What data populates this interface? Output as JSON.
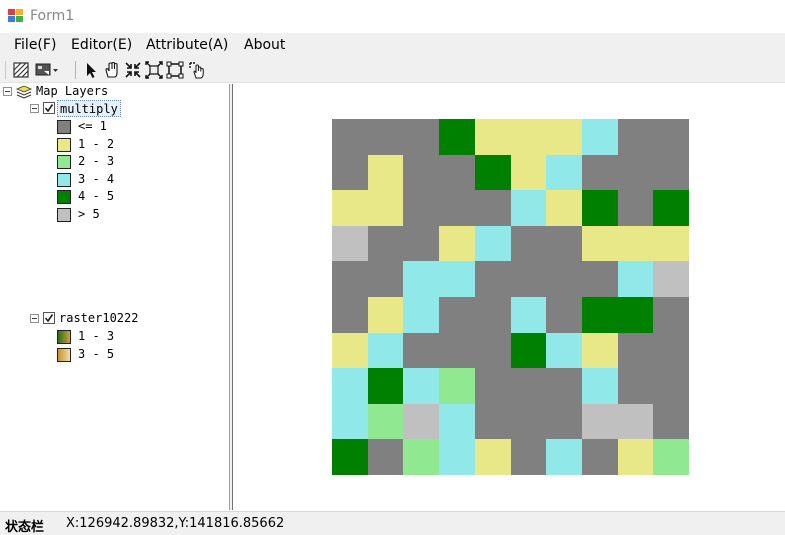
{
  "window": {
    "title": "Form1"
  },
  "menu": {
    "items": [
      "File(F)",
      "Editor(E)",
      "Attribute(A)",
      "About"
    ]
  },
  "toolbar": {
    "tools": [
      "raster-tool-icon",
      "export-dropdown-icon",
      "select-arrow-icon",
      "pan-hand-icon",
      "zoom-in-icon",
      "zoom-out-icon",
      "full-extent-icon",
      "identify-icon"
    ]
  },
  "toc": {
    "root_label": "Map Layers",
    "layers": [
      {
        "name": "multiply",
        "checked": true,
        "classes": [
          {
            "label": "<= 1",
            "color": "#808080"
          },
          {
            "label": "1 - 2",
            "color": "#e8e888"
          },
          {
            "label": "2 - 3",
            "color": "#90e890"
          },
          {
            "label": "3 - 4",
            "color": "#90e8e8"
          },
          {
            "label": "4 - 5",
            "color": "#008000"
          },
          {
            "label": "> 5",
            "color": "#c0c0c0"
          }
        ]
      },
      {
        "name": "raster10222",
        "checked": true,
        "classes": [
          {
            "label": "1 - 3",
            "gradient": [
              "#2e6b1a",
              "#c8a040"
            ]
          },
          {
            "label": "3 - 5",
            "gradient": [
              "#c89030",
              "#f0e0a0"
            ]
          }
        ]
      }
    ]
  },
  "raster_grid": [
    [
      0,
      0,
      0,
      4,
      1,
      1,
      1,
      3,
      0,
      0
    ],
    [
      0,
      1,
      0,
      0,
      4,
      1,
      3,
      0,
      0,
      0
    ],
    [
      1,
      1,
      0,
      0,
      0,
      3,
      1,
      4,
      0,
      4
    ],
    [
      5,
      0,
      0,
      1,
      3,
      0,
      0,
      1,
      1,
      1
    ],
    [
      0,
      0,
      3,
      3,
      0,
      0,
      0,
      0,
      3,
      5
    ],
    [
      0,
      1,
      3,
      0,
      0,
      3,
      0,
      4,
      4,
      0
    ],
    [
      1,
      3,
      0,
      0,
      0,
      4,
      3,
      1,
      0,
      0
    ],
    [
      3,
      4,
      3,
      2,
      0,
      0,
      0,
      3,
      0,
      0
    ],
    [
      3,
      2,
      5,
      3,
      0,
      0,
      0,
      5,
      5,
      0
    ],
    [
      4,
      0,
      2,
      3,
      1,
      0,
      3,
      0,
      1,
      2
    ]
  ],
  "status": {
    "label": "状态栏",
    "coordinates": "X:126942.89832,Y:141816.85662"
  }
}
